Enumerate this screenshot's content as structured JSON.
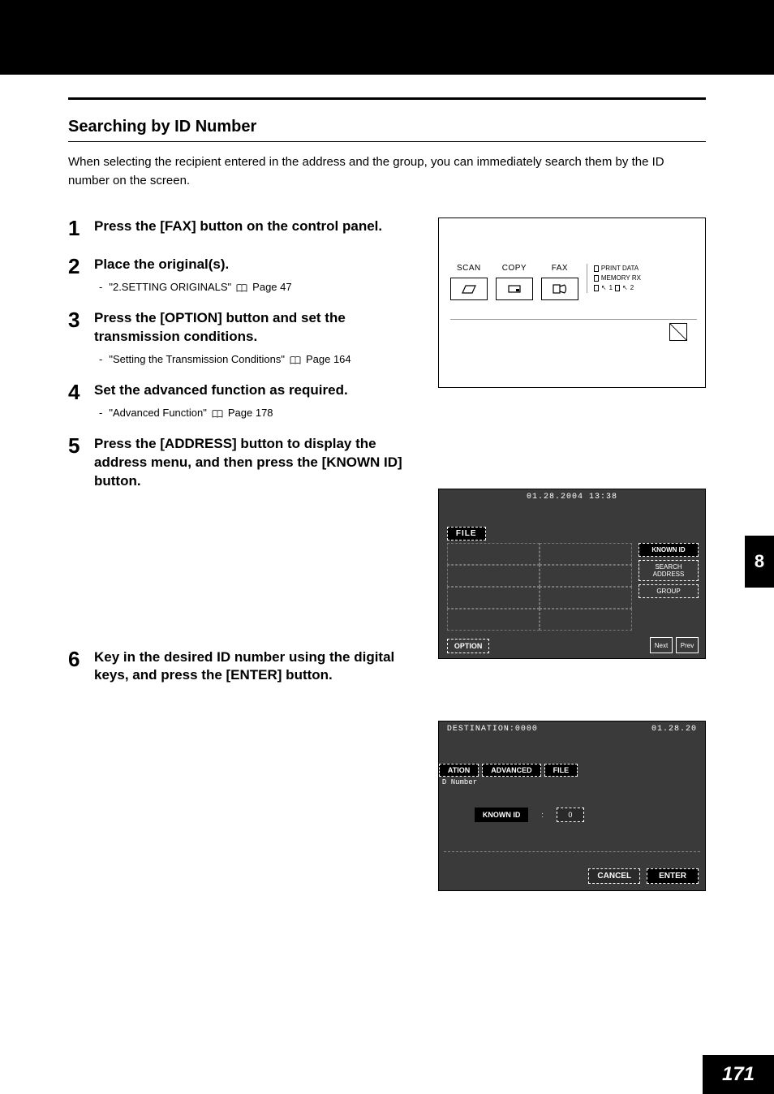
{
  "chapter_tab": "8",
  "page_number": "171",
  "section_title": "Searching by ID Number",
  "intro": "When selecting the recipient entered in the address and the group, you can immediately search them by the ID number on the screen.",
  "steps": [
    {
      "num": "1",
      "title": "Press the [FAX] button on the control panel."
    },
    {
      "num": "2",
      "title": "Place the original(s).",
      "ref_text": "\"2.SETTING ORIGINALS\"",
      "ref_page": "Page 47"
    },
    {
      "num": "3",
      "title": "Press the [OPTION] button and set the transmission conditions.",
      "ref_text": "\"Setting the Transmission Conditions\"",
      "ref_page": "Page 164"
    },
    {
      "num": "4",
      "title": "Set the advanced function as required.",
      "ref_text": "\"Advanced Function\"",
      "ref_page": "Page 178"
    },
    {
      "num": "5",
      "title": "Press the [ADDRESS] button to display the address menu, and then press the [KNOWN ID] button."
    },
    {
      "num": "6",
      "title": "Key in the desired ID number using the digital keys, and press the [ENTER] button."
    }
  ],
  "fig_panel": {
    "labels": [
      "SCAN",
      "COPY",
      "FAX"
    ],
    "status": {
      "print": "PRINT DATA",
      "memory": "MEMORY RX",
      "l1": "1",
      "l2": "2"
    }
  },
  "fig_address": {
    "datetime": "01.28.2004 13:38",
    "tab": "FILE",
    "side_buttons": [
      "KNOWN ID",
      "SEARCH ADDRESS",
      "GROUP"
    ],
    "option": "OPTION",
    "nav": {
      "next": "Next",
      "prev": "Prev"
    }
  },
  "fig_enter": {
    "destination": "DESTINATION:0000",
    "date": "01.28.20",
    "tabs": [
      "ATION",
      "ADVANCED",
      "FILE"
    ],
    "id_label": "D Number",
    "known_label": "KNOWN ID",
    "known_sep": ":",
    "known_value": "0",
    "cancel": "CANCEL",
    "enter": "ENTER"
  }
}
